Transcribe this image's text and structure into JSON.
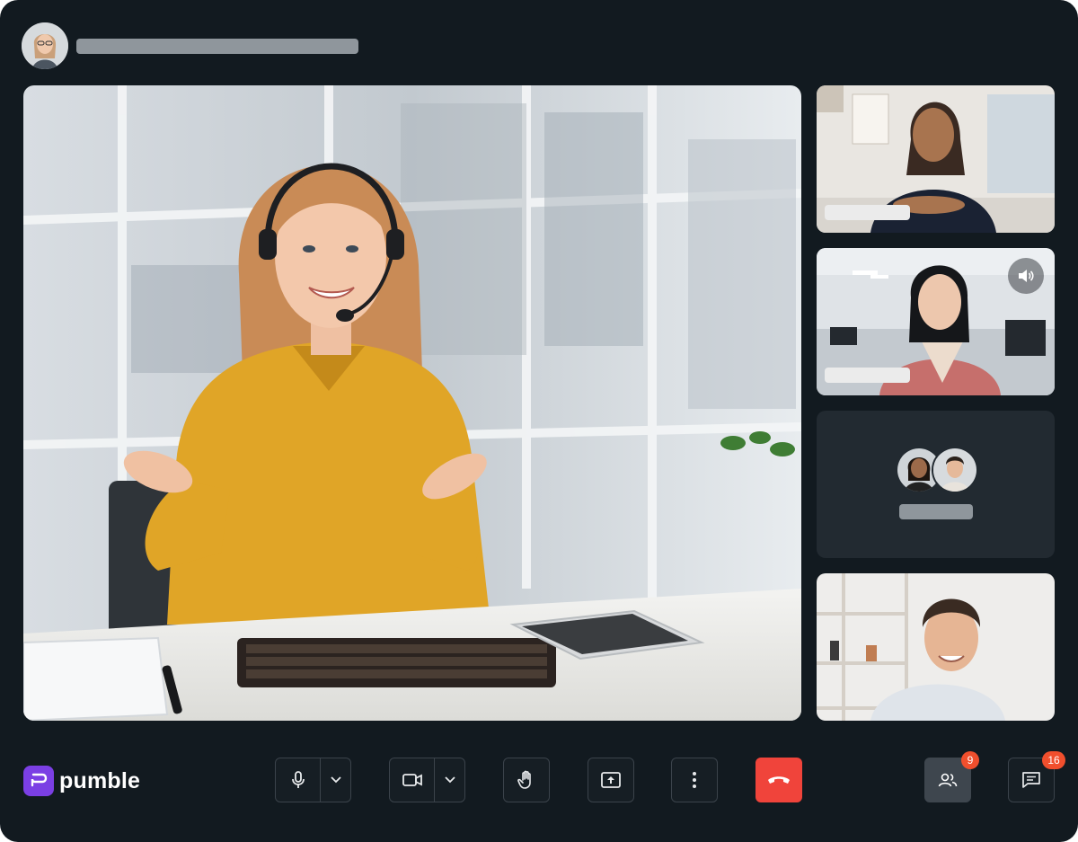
{
  "app": {
    "name": "pumble",
    "brand_color": "#7b3fe4"
  },
  "header": {
    "host_avatar_icon": "avatar"
  },
  "main_stage": {
    "content": "video-feed"
  },
  "participants": [
    {
      "kind": "video",
      "speaking": false
    },
    {
      "kind": "video",
      "speaking": true,
      "icon": "speaker-icon"
    },
    {
      "kind": "audio-only",
      "icon": "avatar-group"
    },
    {
      "kind": "video",
      "speaking": false
    }
  ],
  "controls": {
    "mic_icon": "microphone-icon",
    "camera_icon": "video-camera-icon",
    "raise_hand_icon": "hand-icon",
    "share_icon": "screen-share-icon",
    "more_icon": "more-vertical-icon",
    "end_call_icon": "phone-hangup-icon",
    "end_call_color": "#f0443b"
  },
  "sidebar_toggles": {
    "people_icon": "people-icon",
    "people_count": "9",
    "chat_icon": "chat-icon",
    "chat_count": "16",
    "badge_color": "#f04f2d"
  }
}
